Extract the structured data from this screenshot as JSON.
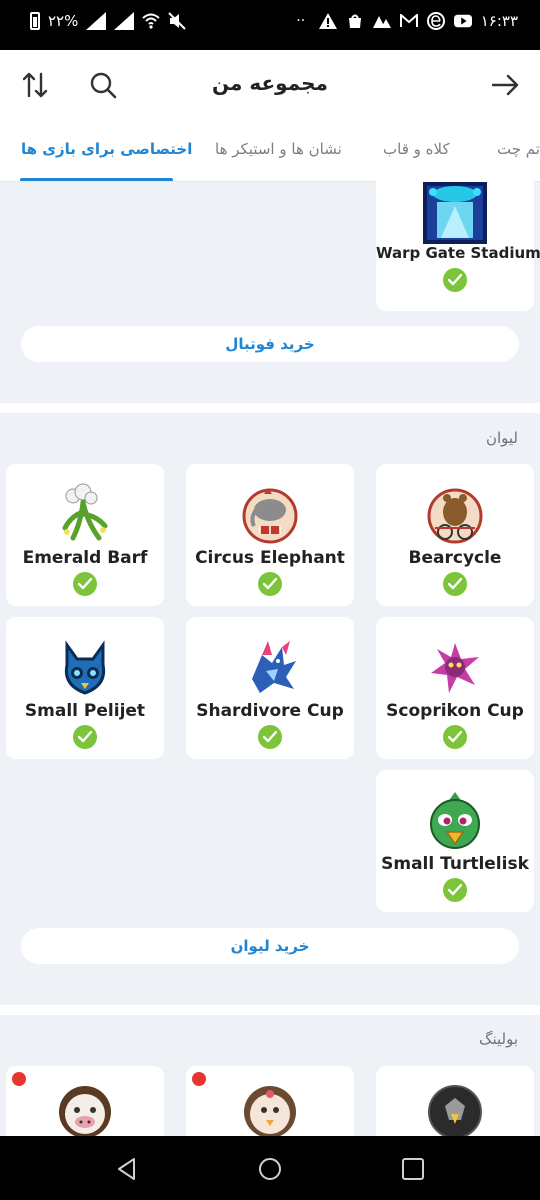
{
  "status_bar": {
    "battery_percent": "۲۲%",
    "time": "۱۶:۳۳"
  },
  "header": {
    "title": "مجموعه من",
    "icons": [
      "sort-icon",
      "search-icon",
      "back-arrow-icon"
    ]
  },
  "tabs": [
    {
      "label": "اختصاصی برای بازی ها",
      "active": true
    },
    {
      "label": "نشان ها و استیکر ها",
      "active": false
    },
    {
      "label": "کلاه و قاب",
      "active": false
    },
    {
      "label": "تم چت",
      "active": false
    }
  ],
  "football": {
    "items": [
      {
        "name": "Warp Gate Stadium",
        "owned": true
      }
    ],
    "buy_label": "خرید فوتبال"
  },
  "cups": {
    "label": "لیوان",
    "items": [
      {
        "name": "Bearcycle",
        "owned": true
      },
      {
        "name": "Circus Elephant",
        "owned": true
      },
      {
        "name": "Emerald Barf",
        "owned": true
      },
      {
        "name": "Scoprikon Cup",
        "owned": true
      },
      {
        "name": "Shardivore Cup",
        "owned": true
      },
      {
        "name": "Small Pelijet",
        "owned": true
      },
      {
        "name": "Small Turtlelisk",
        "owned": true
      }
    ],
    "buy_label": "خرید لیوان"
  },
  "bowling": {
    "label": "بولینگ"
  },
  "colors": {
    "accent": "#1f86d6",
    "check": "#7cc53a",
    "new_dot": "#e8352d",
    "background": "#eef1f5"
  }
}
